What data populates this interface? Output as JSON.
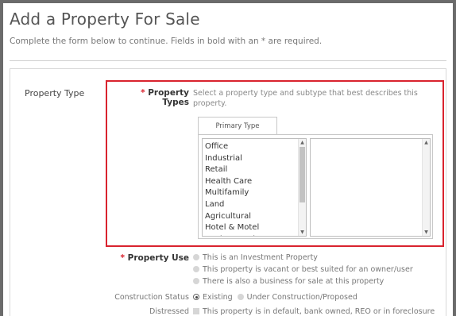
{
  "page": {
    "title": "Add a Property For Sale",
    "subtitle": "Complete the form below to continue. Fields in bold with an * are required."
  },
  "property_type_section": {
    "label": "Property Type",
    "required_star": "*",
    "field_label": "Property Types",
    "help_text": "Select a property type and subtype that best describes this property.",
    "tab_label": "Primary Type",
    "primary_types": [
      "Office",
      "Industrial",
      "Retail",
      "Health Care",
      "Multifamily",
      "Land",
      "Agricultural",
      "Hotel & Motel",
      "Senior Housing"
    ]
  },
  "property_use": {
    "required_star": "*",
    "label": "Property Use",
    "options": [
      "This is an Investment Property",
      "This property is vacant or best suited for an owner/user",
      "There is also a business for sale at this property"
    ]
  },
  "construction_status": {
    "label": "Construction Status",
    "options": [
      "Existing",
      "Under Construction/Proposed"
    ],
    "selected": "Existing"
  },
  "distressed": {
    "label": "Distressed",
    "option": "This property is in default, bank owned, REO or in foreclosure"
  },
  "colors": {
    "highlight": "#d9232e",
    "required": "#d9232e"
  }
}
